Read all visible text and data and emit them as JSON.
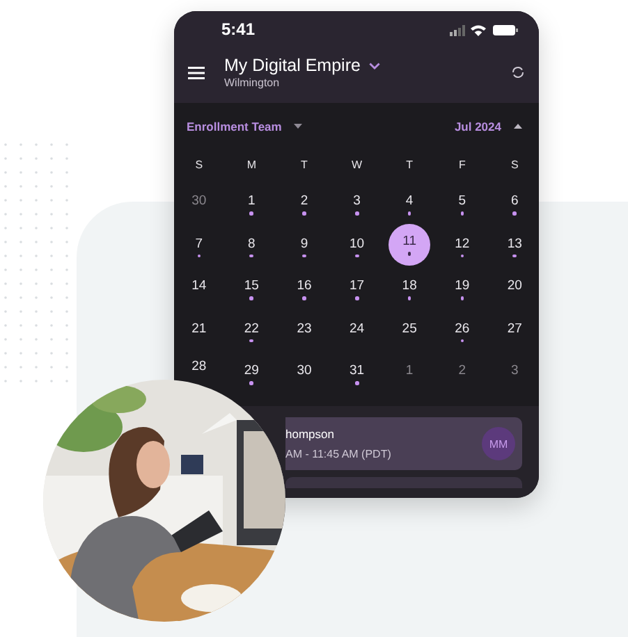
{
  "status_bar": {
    "time": "5:41"
  },
  "header": {
    "title": "My Digital Empire",
    "subtitle": "Wilmington"
  },
  "toolbar": {
    "team": "Enrollment Team",
    "month": "Jul 2024"
  },
  "weekdays": [
    "S",
    "M",
    "T",
    "W",
    "T",
    "F",
    "S"
  ],
  "weeks": [
    [
      {
        "label": "30",
        "outside": true,
        "has_events": false,
        "selected": false
      },
      {
        "label": "1",
        "outside": false,
        "has_events": true,
        "selected": false
      },
      {
        "label": "2",
        "outside": false,
        "has_events": true,
        "selected": false
      },
      {
        "label": "3",
        "outside": false,
        "has_events": true,
        "selected": false
      },
      {
        "label": "4",
        "outside": false,
        "has_events": true,
        "selected": false
      },
      {
        "label": "5",
        "outside": false,
        "has_events": true,
        "selected": false
      },
      {
        "label": "6",
        "outside": false,
        "has_events": true,
        "selected": false
      }
    ],
    [
      {
        "label": "7",
        "outside": false,
        "has_events": true,
        "selected": false
      },
      {
        "label": "8",
        "outside": false,
        "has_events": true,
        "selected": false
      },
      {
        "label": "9",
        "outside": false,
        "has_events": true,
        "selected": false
      },
      {
        "label": "10",
        "outside": false,
        "has_events": true,
        "selected": false
      },
      {
        "label": "11",
        "outside": false,
        "has_events": true,
        "selected": true
      },
      {
        "label": "12",
        "outside": false,
        "has_events": true,
        "selected": false
      },
      {
        "label": "13",
        "outside": false,
        "has_events": true,
        "selected": false
      }
    ],
    [
      {
        "label": "14",
        "outside": false,
        "has_events": false,
        "selected": false
      },
      {
        "label": "15",
        "outside": false,
        "has_events": true,
        "selected": false
      },
      {
        "label": "16",
        "outside": false,
        "has_events": true,
        "selected": false
      },
      {
        "label": "17",
        "outside": false,
        "has_events": true,
        "selected": false
      },
      {
        "label": "18",
        "outside": false,
        "has_events": true,
        "selected": false
      },
      {
        "label": "19",
        "outside": false,
        "has_events": true,
        "selected": false
      },
      {
        "label": "20",
        "outside": false,
        "has_events": false,
        "selected": false
      }
    ],
    [
      {
        "label": "21",
        "outside": false,
        "has_events": false,
        "selected": false
      },
      {
        "label": "22",
        "outside": false,
        "has_events": true,
        "selected": false
      },
      {
        "label": "23",
        "outside": false,
        "has_events": false,
        "selected": false
      },
      {
        "label": "24",
        "outside": false,
        "has_events": false,
        "selected": false
      },
      {
        "label": "25",
        "outside": false,
        "has_events": false,
        "selected": false
      },
      {
        "label": "26",
        "outside": false,
        "has_events": true,
        "selected": false
      },
      {
        "label": "27",
        "outside": false,
        "has_events": false,
        "selected": false
      }
    ],
    [
      {
        "label": "28",
        "outside": false,
        "selected": false
      },
      {
        "label": "29",
        "outside": false,
        "has_events": true,
        "selected": false
      },
      {
        "label": "30",
        "outside": false,
        "has_events": false,
        "selected": false
      },
      {
        "label": "31",
        "outside": false,
        "has_events": true,
        "selected": false
      },
      {
        "label": "1",
        "outside": true,
        "has_events": false,
        "selected": false
      },
      {
        "label": "2",
        "outside": true,
        "has_events": false,
        "selected": false
      },
      {
        "label": "3",
        "outside": true,
        "has_events": false,
        "selected": false
      }
    ]
  ],
  "event": {
    "title": "hompson",
    "time": "AM - 11:45 AM (PDT)",
    "initials": "MM"
  }
}
